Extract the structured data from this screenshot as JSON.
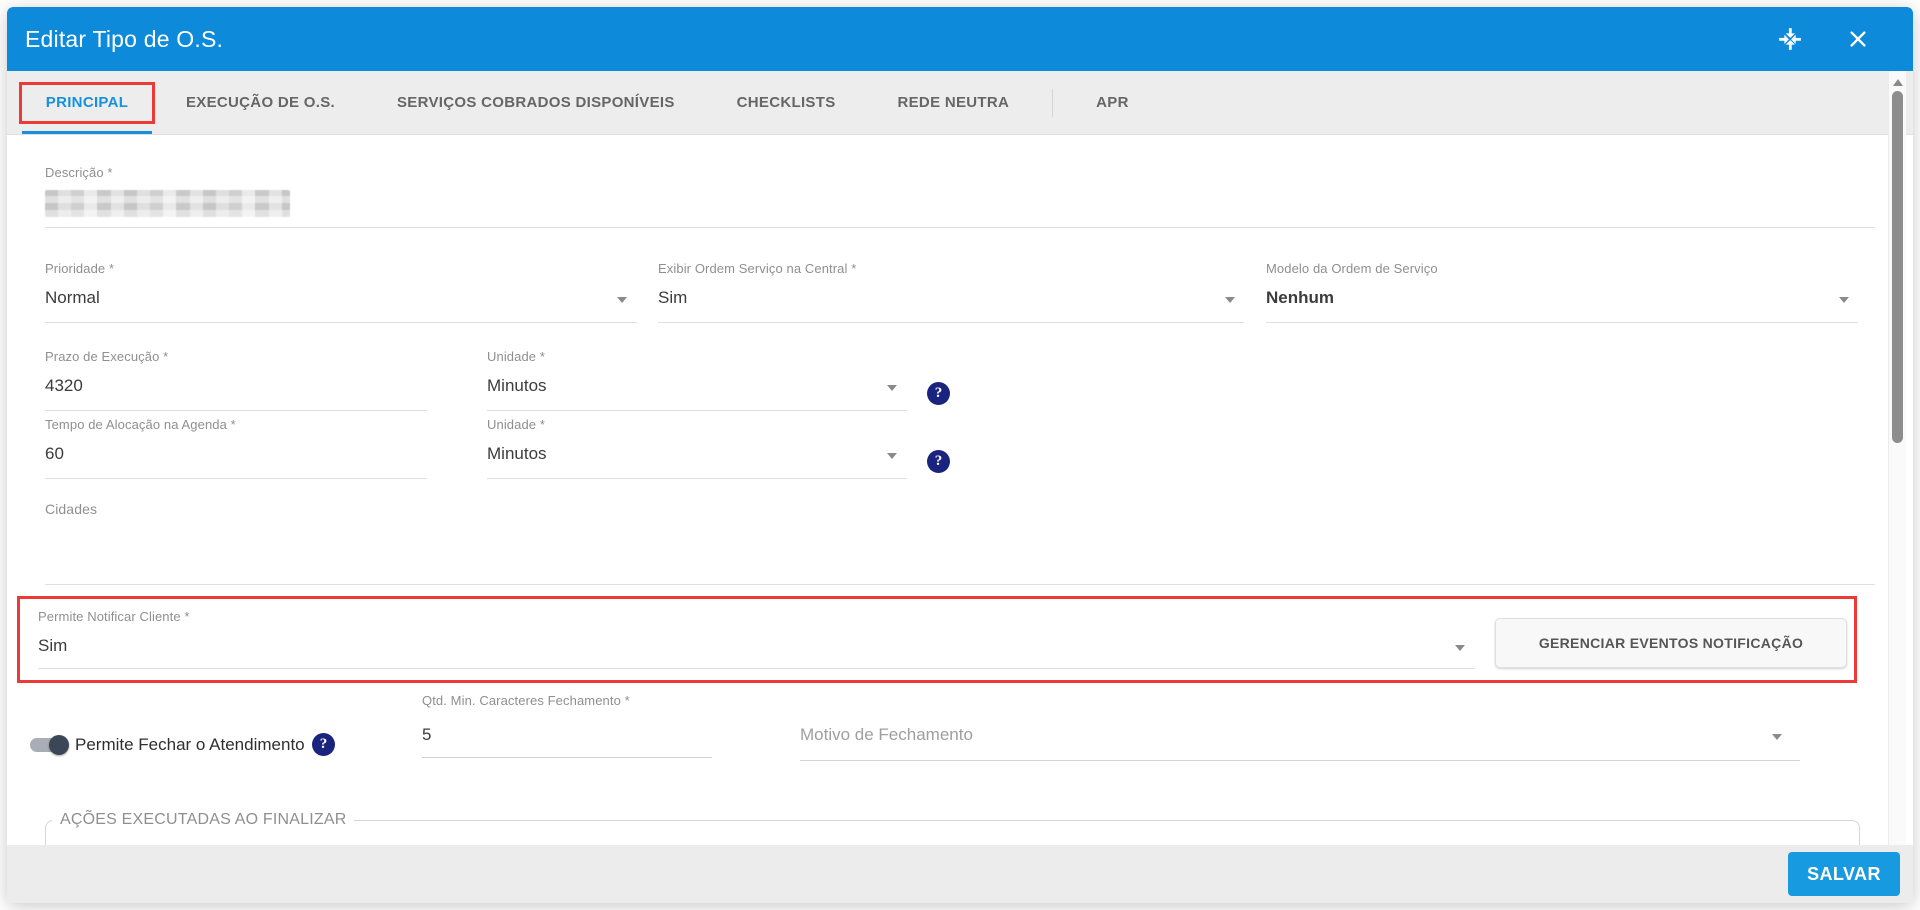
{
  "dialog": {
    "title": "Editar Tipo de O.S."
  },
  "colors": {
    "header_blue": "#0d8ad9",
    "accent_blue": "#1791db",
    "save_blue": "#189ae1",
    "highlight_red": "#ee3a37",
    "help_navy": "#1a237e"
  },
  "icons": {
    "help": "?"
  },
  "tabs": [
    {
      "label": "PRINCIPAL",
      "active": true
    },
    {
      "label": "EXECUÇÃO DE O.S.",
      "active": false
    },
    {
      "label": "SERVIÇOS COBRADOS DISPONÍVEIS",
      "active": false
    },
    {
      "label": "CHECKLISTS",
      "active": false
    },
    {
      "label": "REDE NEUTRA",
      "active": false
    },
    {
      "label": "APR",
      "active": false
    }
  ],
  "form": {
    "descricao": {
      "label": "Descrição *",
      "value_redacted": true
    },
    "prioridade": {
      "label": "Prioridade *",
      "value": "Normal"
    },
    "exibir_central": {
      "label": "Exibir Ordem Serviço na Central *",
      "value": "Sim"
    },
    "modelo_os": {
      "label": "Modelo da Ordem de Serviço",
      "value": "Nenhum"
    },
    "prazo_execucao": {
      "label": "Prazo de Execução *",
      "value": "4320"
    },
    "prazo_unidade": {
      "label": "Unidade *",
      "value": "Minutos"
    },
    "tempo_alocacao": {
      "label": "Tempo de Alocação na Agenda *",
      "value": "60"
    },
    "tempo_unidade": {
      "label": "Unidade *",
      "value": "Minutos"
    },
    "cidades": {
      "label": "Cidades",
      "value": ""
    },
    "permite_notificar": {
      "label": "Permite Notificar Cliente *",
      "value": "Sim"
    },
    "gerenciar_eventos_button": "GERENCIAR EVENTOS NOTIFICAÇÃO",
    "permite_fechar": {
      "label": "Permite Fechar o Atendimento",
      "enabled": true
    },
    "qtd_min_caracteres": {
      "label": "Qtd. Min. Caracteres Fechamento *",
      "value": "5"
    },
    "motivo_fechamento": {
      "label": "Motivo de Fechamento",
      "value": ""
    },
    "acoes_finalizar_legend": "AÇÕES EXECUTADAS AO FINALIZAR"
  },
  "footer": {
    "save_label": "SALVAR"
  }
}
